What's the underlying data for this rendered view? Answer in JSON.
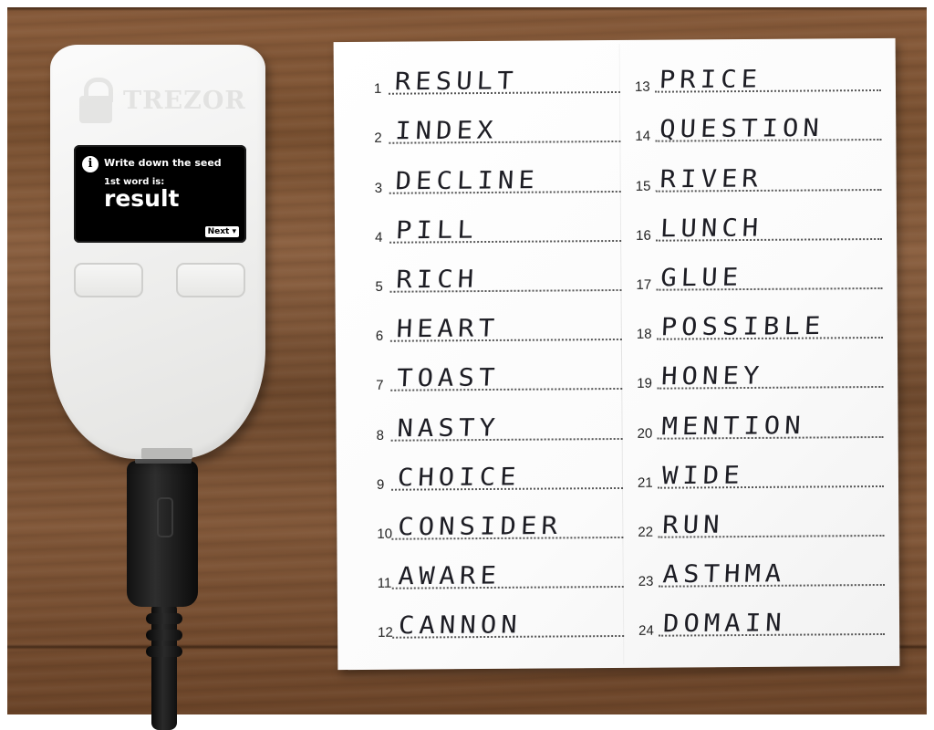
{
  "device": {
    "brand": "TREZOR",
    "screen": {
      "title": "Write down the seed",
      "subtitle": "1st word is:",
      "word": "result",
      "next": "Next ▾"
    }
  },
  "seed_card": {
    "left_column": [
      {
        "num": "1",
        "word": "RESULT"
      },
      {
        "num": "2",
        "word": "INDEX"
      },
      {
        "num": "3",
        "word": "DECLINE"
      },
      {
        "num": "4",
        "word": "PILL"
      },
      {
        "num": "5",
        "word": "RICH"
      },
      {
        "num": "6",
        "word": "HEART"
      },
      {
        "num": "7",
        "word": "TOAST"
      },
      {
        "num": "8",
        "word": "NASTY"
      },
      {
        "num": "9",
        "word": "CHOICE"
      },
      {
        "num": "10",
        "word": "CONSIDER"
      },
      {
        "num": "11",
        "word": "AWARE"
      },
      {
        "num": "12",
        "word": "CANNON"
      }
    ],
    "right_column": [
      {
        "num": "13",
        "word": "PRICE"
      },
      {
        "num": "14",
        "word": "QUESTION"
      },
      {
        "num": "15",
        "word": "RIVER"
      },
      {
        "num": "16",
        "word": "LUNCH"
      },
      {
        "num": "17",
        "word": "GLUE"
      },
      {
        "num": "18",
        "word": "POSSIBLE"
      },
      {
        "num": "19",
        "word": "HONEY"
      },
      {
        "num": "20",
        "word": "MENTION"
      },
      {
        "num": "21",
        "word": "WIDE"
      },
      {
        "num": "22",
        "word": "RUN"
      },
      {
        "num": "23",
        "word": "ASTHMA"
      },
      {
        "num": "24",
        "word": "DOMAIN"
      }
    ]
  },
  "colors": {
    "wood": "#7b5232",
    "device_body": "#f0f0ef",
    "screen": "#000000",
    "ink": "#1d1d24"
  }
}
